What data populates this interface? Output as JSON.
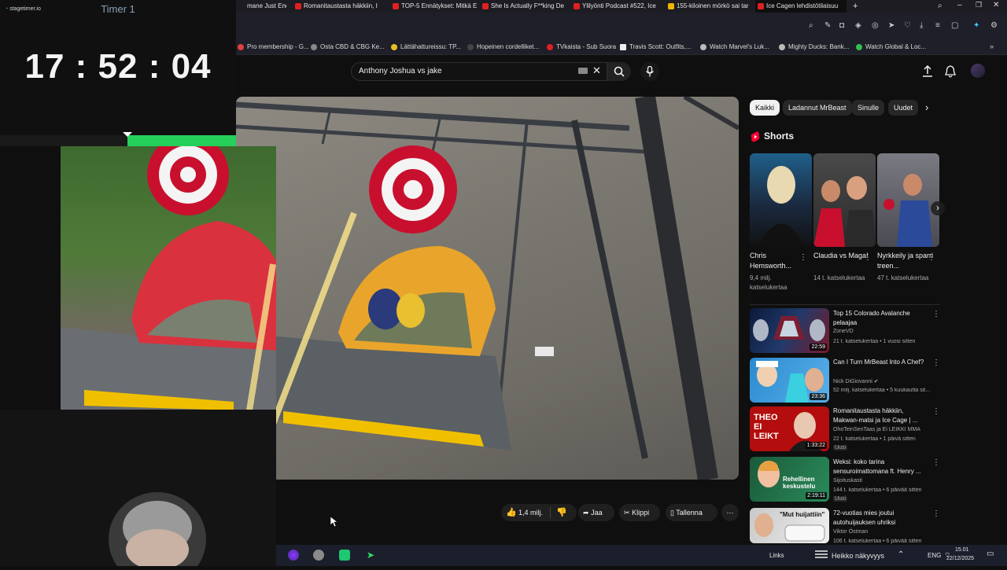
{
  "timer": {
    "brand": "stagetimer.io",
    "title": "Timer 1",
    "clock": "17 : 52 : 04",
    "progress_fraction": 0.46
  },
  "browser": {
    "tabs": [
      {
        "label": "mane Just Ended |",
        "icon": "page-icon"
      },
      {
        "label": "Romanitaustasta häkkiin, I",
        "icon": "youtube-icon"
      },
      {
        "label": "TOP-5 Ennätykset: Mitkä E",
        "icon": "youtube-icon"
      },
      {
        "label": "She Is Actually F**king De",
        "icon": "youtube-icon"
      },
      {
        "label": "Ylilyönti Podcast #522, Ice",
        "icon": "youtube-icon"
      },
      {
        "label": "155-kiloinen mörkö sai tar",
        "icon": "news-icon"
      },
      {
        "label": "Ice Cagen lehdistötilaisuu",
        "icon": "youtube-icon"
      }
    ],
    "new_tab": "+",
    "bookmarks": [
      "Pro membership - G...",
      "Osta CBD & CBG Ke...",
      "Lättähattureissu: TP...",
      "Hopeinen cordelliket...",
      "TVkaista - Sub Suora",
      "Travis Scott: Outfits,...",
      "Watch Marvel's Luk...",
      "Mighty Ducks: Bank...",
      "Watch Global & Loc..."
    ]
  },
  "youtube": {
    "search_value": "Anthony Joshua vs jake",
    "chips": [
      "Kaikki",
      "Ladannut MrBeast",
      "Sinulle",
      "Uudet"
    ],
    "shorts_title": "Shorts",
    "shorts": [
      {
        "title": "Chris Hemsworth...",
        "views": "9,4 milj. katselukertaa"
      },
      {
        "title": "Claudia vs Maga!",
        "views": "14 t. katselukertaa"
      },
      {
        "title": "Nyrkkeily ja sparri treen...",
        "views": "47 t. katselukertaa"
      }
    ],
    "recommended": [
      {
        "title": "Top 15 Colorado Avalanche pelaajaa",
        "channel": "ZoneVD",
        "meta": "21 t. katselukertaa • 1 vuosi sitten",
        "duration": "22:59",
        "badge": ""
      },
      {
        "title": "Can I Turn MrBeast Into A Chef?",
        "channel": "Nick DiGiovanni",
        "meta": "52 milj. katselukertaa • 5 kuukautta sit...",
        "duration": "23:36",
        "badge": ""
      },
      {
        "title": "Romanitaustasta häkkiin, Makwan-matsi ja Ice Cage | ...",
        "channel": "OhoTeinSenTaas ja Ei LEIKKI MMA",
        "meta": "22 t. katselukertaa • 1 päivä sitten",
        "duration": "1:33:22",
        "badge": "Uusi",
        "thumb_text": "THEO EI LEIKT"
      },
      {
        "title": "Weksi: koko tarina sensuroimattomana ft. Henry ...",
        "channel": "Sijoituskasti",
        "meta": "144 t. katselukertaa • 6 päivää sitten",
        "duration": "2:19:11",
        "badge": "Uusi",
        "thumb_text": "Rehellinen keskustelu"
      },
      {
        "title": "72-vuotias mies joutui autohuijauksen uhriksi",
        "channel": "Viktor Östman",
        "meta": "106 t. katselukertaa • 6 päivää sitten",
        "duration": "",
        "badge": "",
        "thumb_text": "\"Mut huijattiin\""
      }
    ],
    "actions": {
      "like": "1,4 milj.",
      "share": "Jaa",
      "clip": "Klippi",
      "save": "Tallenna"
    }
  },
  "taskbar": {
    "links": "Links",
    "weather": "Heikko näkyvyys",
    "lang": "ENG",
    "time": "15.01",
    "date": "22/12/2025"
  },
  "colors": {
    "timer_progress": "#25d05a",
    "youtube_red": "#ff0033",
    "background": "#0f0f0f"
  }
}
